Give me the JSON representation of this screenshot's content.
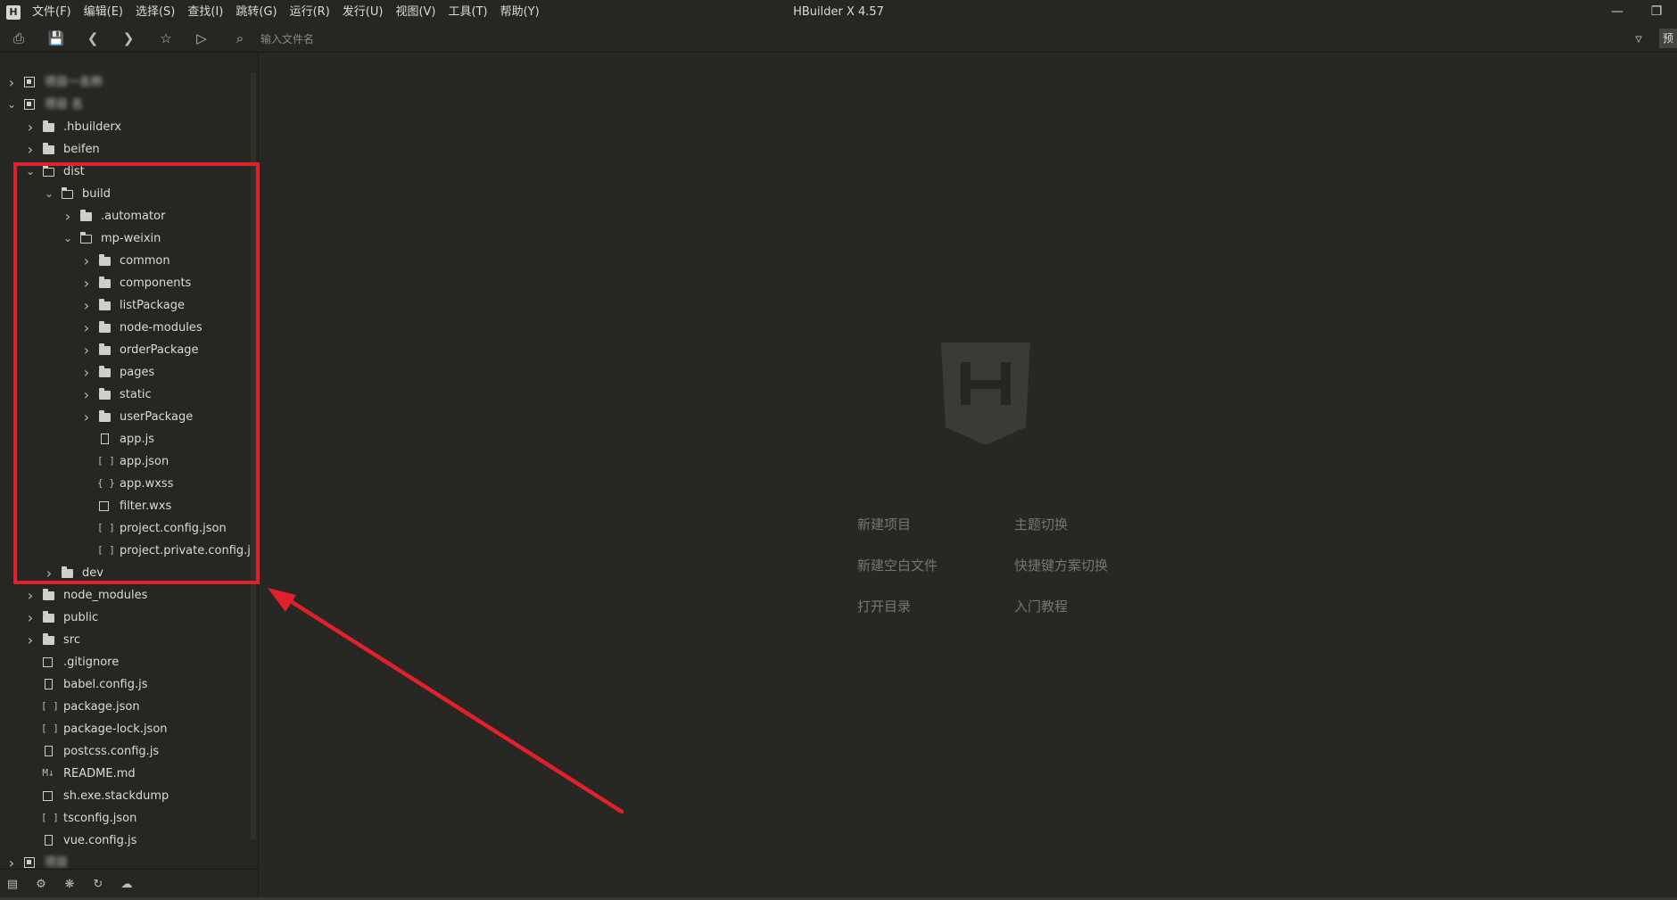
{
  "window": {
    "title": "HBuilder X 4.57",
    "logo": "H",
    "minimize_icon": "minimize-icon",
    "restore_icon": "restore-icon"
  },
  "menu": [
    "文件(F)",
    "编辑(E)",
    "选择(S)",
    "查找(I)",
    "跳转(G)",
    "运行(R)",
    "发行(U)",
    "视图(V)",
    "工具(T)",
    "帮助(Y)"
  ],
  "toolbar": {
    "search_placeholder": "输入文件名",
    "icons": [
      "new-file-icon",
      "save-icon",
      "back-icon",
      "forward-icon",
      "star-icon",
      "run-icon",
      "find-file-icon",
      "filter-icon"
    ],
    "right_tab": "预"
  },
  "tree": [
    {
      "label": "项目一名称",
      "depth": 0,
      "kind": "project",
      "expanded": false,
      "blurred": true
    },
    {
      "label": "项目 名",
      "depth": 0,
      "kind": "project",
      "expanded": true,
      "blurred": true
    },
    {
      "label": ".hbuilderx",
      "depth": 1,
      "kind": "folder",
      "expanded": false
    },
    {
      "label": "beifen",
      "depth": 1,
      "kind": "folder",
      "expanded": false
    },
    {
      "label": "dist",
      "depth": 1,
      "kind": "folder",
      "expanded": true
    },
    {
      "label": "build",
      "depth": 2,
      "kind": "folder",
      "expanded": true
    },
    {
      "label": ".automator",
      "depth": 3,
      "kind": "folder",
      "expanded": false
    },
    {
      "label": "mp-weixin",
      "depth": 3,
      "kind": "folder",
      "expanded": true
    },
    {
      "label": "common",
      "depth": 4,
      "kind": "folder",
      "expanded": false
    },
    {
      "label": "components",
      "depth": 4,
      "kind": "folder",
      "expanded": false
    },
    {
      "label": "listPackage",
      "depth": 4,
      "kind": "folder",
      "expanded": false
    },
    {
      "label": "node-modules",
      "depth": 4,
      "kind": "folder",
      "expanded": false
    },
    {
      "label": "orderPackage",
      "depth": 4,
      "kind": "folder",
      "expanded": false
    },
    {
      "label": "pages",
      "depth": 4,
      "kind": "folder",
      "expanded": false
    },
    {
      "label": "static",
      "depth": 4,
      "kind": "folder",
      "expanded": false
    },
    {
      "label": "userPackage",
      "depth": 4,
      "kind": "folder",
      "expanded": false
    },
    {
      "label": "app.js",
      "depth": 4,
      "kind": "js"
    },
    {
      "label": "app.json",
      "depth": 4,
      "kind": "json"
    },
    {
      "label": "app.wxss",
      "depth": 4,
      "kind": "css"
    },
    {
      "label": "filter.wxs",
      "depth": 4,
      "kind": "file"
    },
    {
      "label": "project.config.json",
      "depth": 4,
      "kind": "json"
    },
    {
      "label": "project.private.config.j...",
      "depth": 4,
      "kind": "json"
    },
    {
      "label": "dev",
      "depth": 2,
      "kind": "folder",
      "expanded": false
    },
    {
      "label": "node_modules",
      "depth": 1,
      "kind": "folder",
      "expanded": false
    },
    {
      "label": "public",
      "depth": 1,
      "kind": "folder",
      "expanded": false
    },
    {
      "label": "src",
      "depth": 1,
      "kind": "folder",
      "expanded": false
    },
    {
      "label": ".gitignore",
      "depth": 1,
      "kind": "file"
    },
    {
      "label": "babel.config.js",
      "depth": 1,
      "kind": "js"
    },
    {
      "label": "package.json",
      "depth": 1,
      "kind": "json"
    },
    {
      "label": "package-lock.json",
      "depth": 1,
      "kind": "json"
    },
    {
      "label": "postcss.config.js",
      "depth": 1,
      "kind": "js"
    },
    {
      "label": "README.md",
      "depth": 1,
      "kind": "md"
    },
    {
      "label": "sh.exe.stackdump",
      "depth": 1,
      "kind": "file"
    },
    {
      "label": "tsconfig.json",
      "depth": 1,
      "kind": "json"
    },
    {
      "label": "vue.config.js",
      "depth": 1,
      "kind": "js"
    },
    {
      "label": "项目",
      "depth": 0,
      "kind": "project",
      "expanded": false,
      "blurred": true
    }
  ],
  "sidebar_footer_icons": [
    "project-manager-icon",
    "plugin-icon",
    "debug-icon",
    "git-icon",
    "cloud-icon"
  ],
  "welcome": {
    "left": [
      "新建项目",
      "新建空白文件",
      "打开目录"
    ],
    "right": [
      "主题切换",
      "快捷键方案切换",
      "入门教程"
    ]
  },
  "annotation": {
    "color": "#e0202a"
  }
}
